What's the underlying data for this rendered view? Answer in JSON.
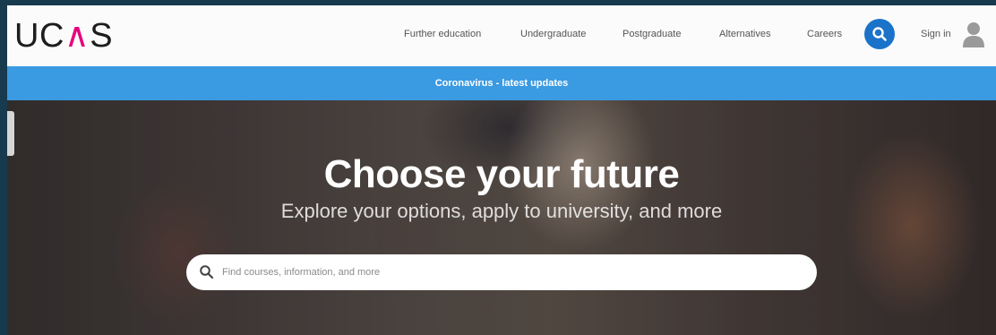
{
  "header": {
    "logo": "UCAS",
    "nav": [
      {
        "label": "Further education"
      },
      {
        "label": "Undergraduate"
      },
      {
        "label": "Postgraduate"
      },
      {
        "label": "Alternatives"
      },
      {
        "label": "Careers"
      }
    ],
    "signin_label": "Sign in"
  },
  "banner": {
    "text": "Coronavirus - latest updates",
    "color": "#3a9ae2"
  },
  "hero": {
    "title": "Choose your future",
    "subtitle": "Explore your options, apply to university, and more"
  },
  "search": {
    "placeholder": "Find courses, information, and more",
    "value": ""
  },
  "icons": {
    "search_button": "search-icon",
    "avatar": "user-icon",
    "search_field": "search-icon"
  },
  "colors": {
    "brand_accent": "#e6007e",
    "search_button": "#1a73c9"
  }
}
